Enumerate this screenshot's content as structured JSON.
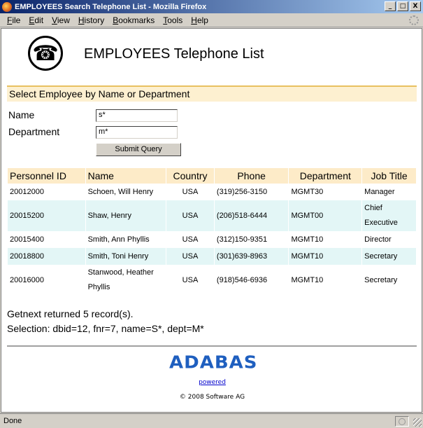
{
  "window": {
    "title": "EMPLOYEES Search Telephone List - Mozilla Firefox",
    "minimize": "_",
    "maximize": "□",
    "close": "X"
  },
  "menu": [
    "File",
    "Edit",
    "View",
    "History",
    "Bookmarks",
    "Tools",
    "Help"
  ],
  "page": {
    "logo_glyph": "☎",
    "title": "EMPLOYEES Telephone List",
    "section_heading": "Select Employee by Name or Department"
  },
  "form": {
    "name_label": "Name",
    "name_value": "s*",
    "department_label": "Department",
    "department_value": "m*",
    "submit_label": "Submit Query"
  },
  "table": {
    "headers": [
      "Personnel ID",
      "Name",
      "Country",
      "Phone",
      "Department",
      "Job Title"
    ],
    "rows": [
      [
        "20012000",
        "Schoen, Will Henry",
        "USA",
        "(319)256-3150",
        "MGMT30",
        "Manager"
      ],
      [
        "20015200",
        "Shaw, Henry",
        "USA",
        "(206)518-6444",
        "MGMT00",
        "Chief Executive"
      ],
      [
        "20015400",
        "Smith, Ann Phyllis",
        "USA",
        "(312)150-9351",
        "MGMT10",
        "Director"
      ],
      [
        "20018800",
        "Smith, Toni Henry",
        "USA",
        "(301)639-8963",
        "MGMT10",
        "Secretary"
      ],
      [
        "20016000",
        "Stanwood, Heather Phyllis",
        "USA",
        "(918)546-6936",
        "MGMT10",
        "Secretary"
      ]
    ]
  },
  "summary": {
    "records": "Getnext returned 5 record(s).",
    "selection": "Selection: dbid=12, fnr=7, name=S*, dept=M*"
  },
  "footer": {
    "brand": "ADABAS",
    "powered": "powered",
    "copyright": "© 2008 Software AG"
  },
  "status": {
    "text": "Done"
  },
  "colors": {
    "header_bg": "#fdebc8",
    "alt_row_bg": "#e3f6f6",
    "brand_blue": "#1f5fbf"
  }
}
